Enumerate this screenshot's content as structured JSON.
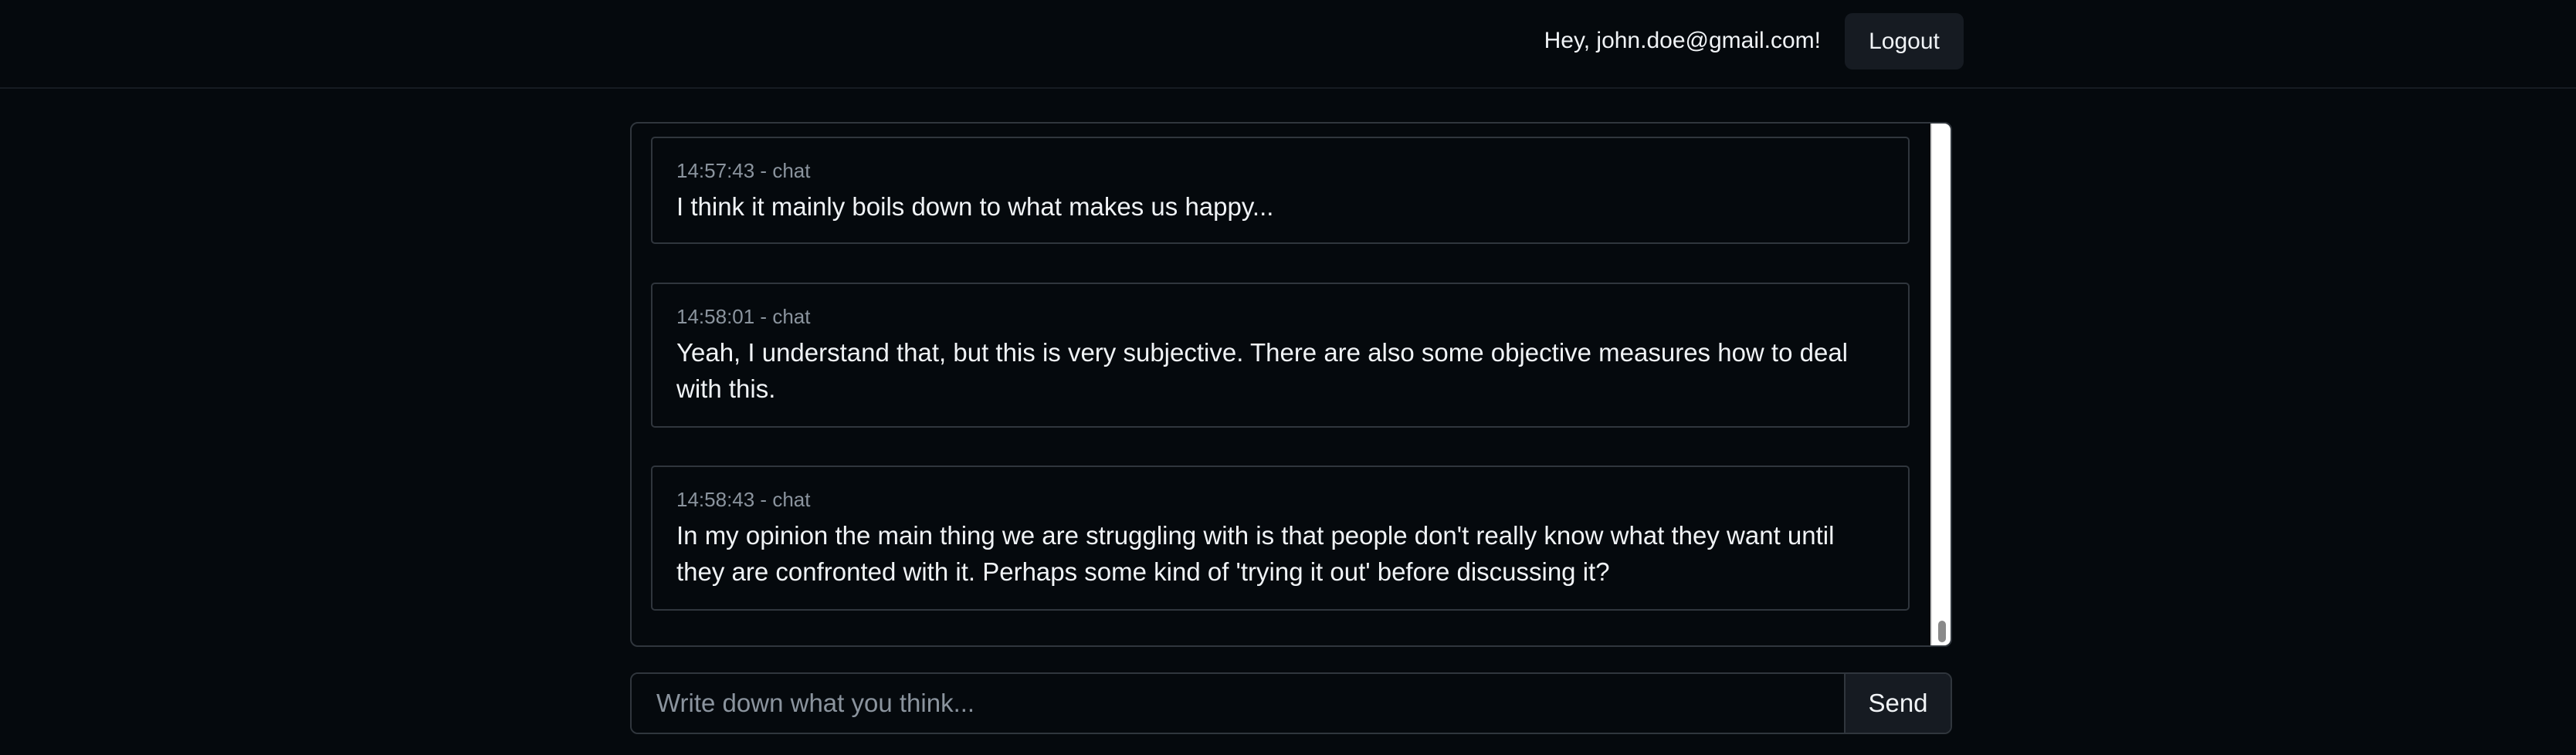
{
  "header": {
    "greeting": "Hey, john.doe@gmail.com!",
    "logout_label": "Logout"
  },
  "chat": {
    "messages": [
      {
        "meta": "14:57:43 - chat",
        "text": "I think it mainly boils down to what makes us happy..."
      },
      {
        "meta": "14:58:01 - chat",
        "text": "Yeah, I understand that, but this is very subjective. There are also some objective measures how to deal with this."
      },
      {
        "meta": "14:58:43 - chat",
        "text": "In my opinion the main thing we are struggling with is that people don't really know what they want until they are confronted with it. Perhaps some kind of 'trying it out' before discussing it?"
      }
    ]
  },
  "composer": {
    "placeholder": "Write down what you think...",
    "value": "",
    "send_label": "Send"
  },
  "colors": {
    "background": "#05090d",
    "border": "#30363d",
    "button_bg": "#161b22",
    "muted_text": "#8b949e",
    "text": "#f0f3f6"
  }
}
